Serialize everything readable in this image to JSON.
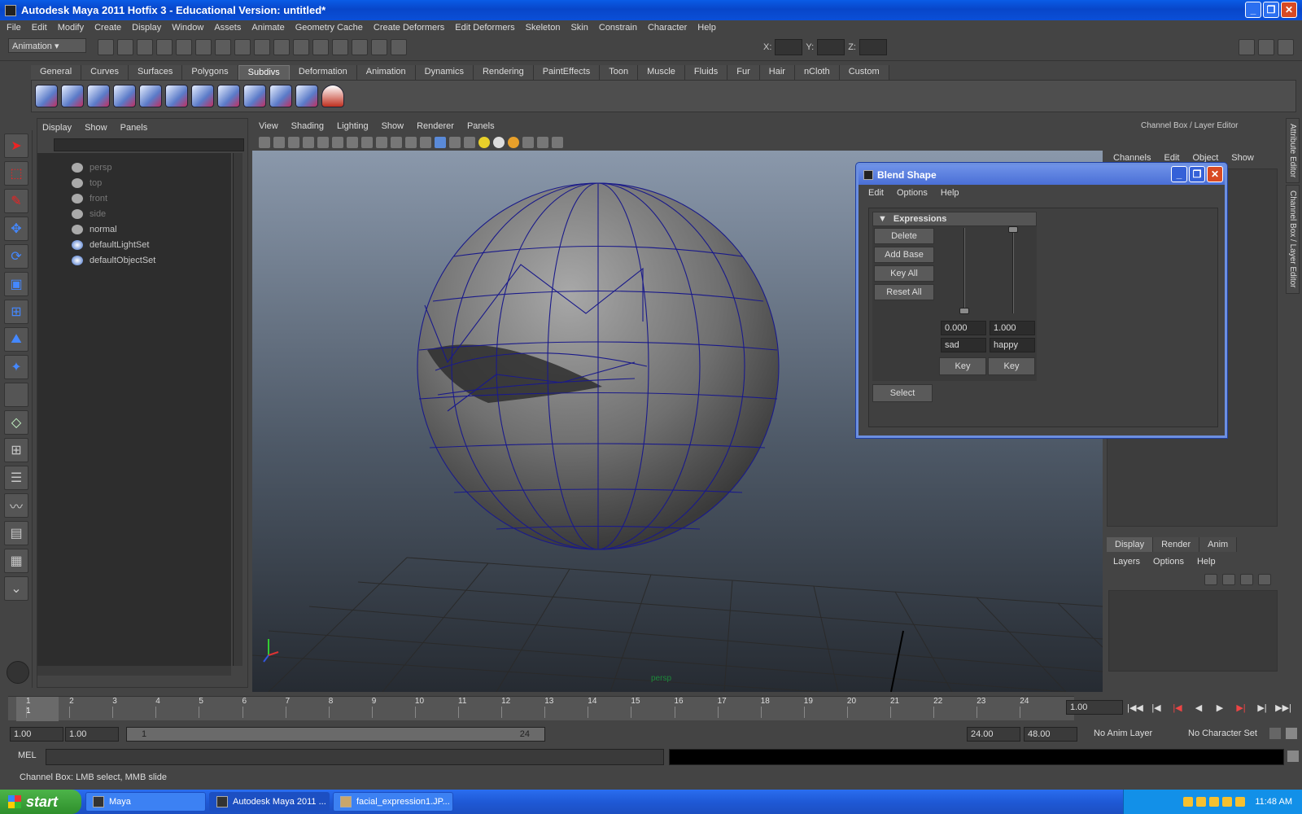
{
  "window": {
    "title": "Autodesk Maya 2011 Hotfix 3 - Educational Version: untitled*"
  },
  "menubar": [
    "File",
    "Edit",
    "Modify",
    "Create",
    "Display",
    "Window",
    "Assets",
    "Animate",
    "Geometry Cache",
    "Create Deformers",
    "Edit Deformers",
    "Skeleton",
    "Skin",
    "Constrain",
    "Character",
    "Help"
  ],
  "status": {
    "mode": "Animation",
    "x_label": "X:",
    "y_label": "Y:",
    "z_label": "Z:"
  },
  "shelf": {
    "tabs": [
      "General",
      "Curves",
      "Surfaces",
      "Polygons",
      "Subdivs",
      "Deformation",
      "Animation",
      "Dynamics",
      "Rendering",
      "PaintEffects",
      "Toon",
      "Muscle",
      "Fluids",
      "Fur",
      "Hair",
      "nCloth",
      "Custom"
    ],
    "active": "Subdivs"
  },
  "outliner": {
    "menu": [
      "Display",
      "Show",
      "Panels"
    ],
    "items": [
      {
        "label": "persp",
        "dim": true
      },
      {
        "label": "top",
        "dim": true
      },
      {
        "label": "front",
        "dim": true
      },
      {
        "label": "side",
        "dim": true
      },
      {
        "label": "normal",
        "dim": false
      },
      {
        "label": "defaultLightSet",
        "dim": false
      },
      {
        "label": "defaultObjectSet",
        "dim": false
      }
    ]
  },
  "viewport": {
    "menu": [
      "View",
      "Shading",
      "Lighting",
      "Show",
      "Renderer",
      "Panels"
    ],
    "camera_label": "persp"
  },
  "channel_box": {
    "title": "Channel Box / Layer Editor",
    "menu": [
      "Channels",
      "Edit",
      "Object",
      "Show"
    ],
    "layer_tabs": [
      "Display",
      "Render",
      "Anim"
    ],
    "layer_menu": [
      "Layers",
      "Options",
      "Help"
    ]
  },
  "side_tabs": [
    "Attribute Editor",
    "Channel Box / Layer Editor"
  ],
  "blend_shape": {
    "title": "Blend Shape",
    "menu": [
      "Edit",
      "Options",
      "Help"
    ],
    "section": "Expressions",
    "buttons": [
      "Delete",
      "Add Base",
      "Key All",
      "Reset All"
    ],
    "targets": [
      {
        "name": "sad",
        "weight": "0.000",
        "key": "Key"
      },
      {
        "name": "happy",
        "weight": "1.000",
        "key": "Key"
      }
    ],
    "select_label": "Select"
  },
  "timeline": {
    "ticks": [
      "1",
      "2",
      "3",
      "4",
      "5",
      "6",
      "7",
      "8",
      "9",
      "10",
      "11",
      "12",
      "13",
      "14",
      "15",
      "16",
      "17",
      "18",
      "19",
      "20",
      "21",
      "22",
      "23",
      "24"
    ],
    "current_marker": "1",
    "current_frame": "1.00"
  },
  "range": {
    "start": "1.00",
    "playback_start": "1.00",
    "slider_start": "1",
    "slider_end": "24",
    "playback_end": "24.00",
    "end": "48.00",
    "anim_layer": "No Anim Layer",
    "character_set": "No Character Set"
  },
  "mel": {
    "label": "MEL"
  },
  "helpline": "Channel Box: LMB select, MMB slide",
  "taskbar": {
    "start_label": "start",
    "tasks": [
      "Maya",
      "Autodesk Maya 2011 ...",
      "facial_expression1.JP..."
    ],
    "clock": "11:48 AM"
  },
  "colors": {
    "xp_blue": "#0846c9",
    "maya_bg": "#444444",
    "wire": "#1a1a8a"
  }
}
